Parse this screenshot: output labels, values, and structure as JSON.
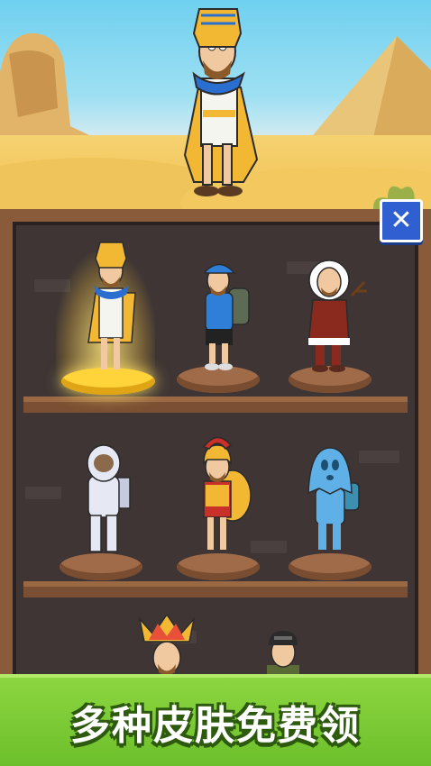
{
  "banner": {
    "text": "多种皮肤免费领"
  },
  "close_button": {
    "icon": "close-icon",
    "symbol": "✕"
  },
  "colors": {
    "banner_green": "#7cca33",
    "close_blue": "#2f5fd0",
    "gold": "#ffd43a",
    "shelf_brown": "#8a5b3a"
  },
  "skins": [
    {
      "name": "pharaoh",
      "selected": true
    },
    {
      "name": "hiker"
    },
    {
      "name": "eskimo"
    },
    {
      "name": "astronaut"
    },
    {
      "name": "spartan"
    },
    {
      "name": "ghost"
    },
    {
      "name": "tribal-chief"
    },
    {
      "name": "soldier"
    }
  ]
}
